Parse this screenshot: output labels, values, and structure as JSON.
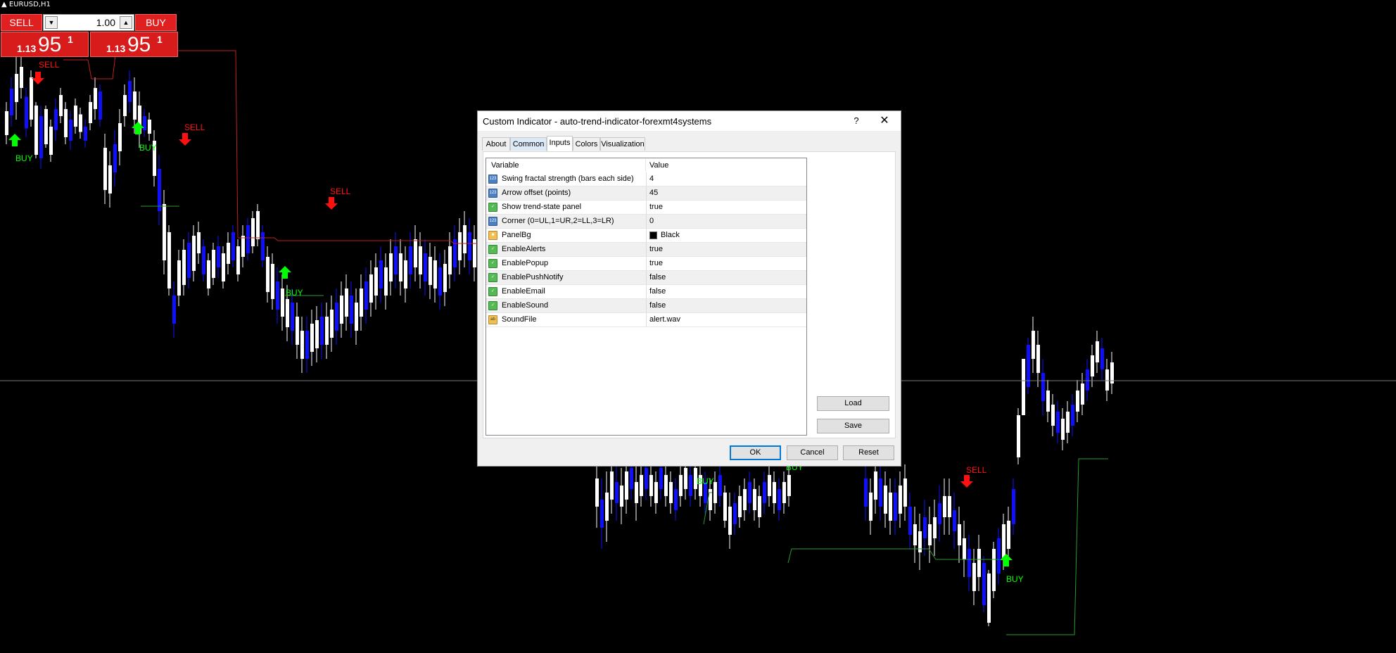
{
  "chart": {
    "symbol": "EURUSD,H1",
    "trade_panel": {
      "sell_label": "SELL",
      "buy_label": "BUY",
      "lot_value": "1.00",
      "sell_price": {
        "small": "1.13",
        "big": "95",
        "sup": "1"
      },
      "buy_price": {
        "small": "1.13",
        "big": "95",
        "sup": "1"
      }
    },
    "signals": {
      "buy": "BUY",
      "sell": "SELL"
    },
    "colors": {
      "bull_candle": "#ffffff",
      "bear_candle": "#1010ff",
      "buy_arrow": "#00ff00",
      "sell_arrow": "#ff1010",
      "resistance": "#c02020",
      "support": "#2a9a2a"
    }
  },
  "dialog": {
    "title": "Custom Indicator - auto-trend-indicator-forexmt4systems",
    "help_glyph": "?",
    "close_glyph": "✕",
    "tabs": [
      "About",
      "Common",
      "Inputs",
      "Colors",
      "Visualization"
    ],
    "active_tab": "Inputs",
    "columns": {
      "variable": "Variable",
      "value": "Value"
    },
    "rows": [
      {
        "type": "num",
        "name": "Swing fractal strength (bars each side)",
        "value": "4"
      },
      {
        "type": "num",
        "name": "Arrow offset (points)",
        "value": "45"
      },
      {
        "type": "bool",
        "name": "Show trend-state panel",
        "value": "true"
      },
      {
        "type": "num",
        "name": "Corner (0=UL,1=UR,2=LL,3=LR)",
        "value": "0"
      },
      {
        "type": "col",
        "name": "PanelBg",
        "value": "Black"
      },
      {
        "type": "bool",
        "name": "EnableAlerts",
        "value": "true"
      },
      {
        "type": "bool",
        "name": "EnablePopup",
        "value": "true"
      },
      {
        "type": "bool",
        "name": "EnablePushNotify",
        "value": "false"
      },
      {
        "type": "bool",
        "name": "EnableEmail",
        "value": "false"
      },
      {
        "type": "bool",
        "name": "EnableSound",
        "value": "false"
      },
      {
        "type": "str",
        "name": "SoundFile",
        "value": "alert.wav"
      }
    ],
    "buttons": {
      "load": "Load",
      "save": "Save",
      "ok": "OK",
      "cancel": "Cancel",
      "reset": "Reset"
    }
  }
}
